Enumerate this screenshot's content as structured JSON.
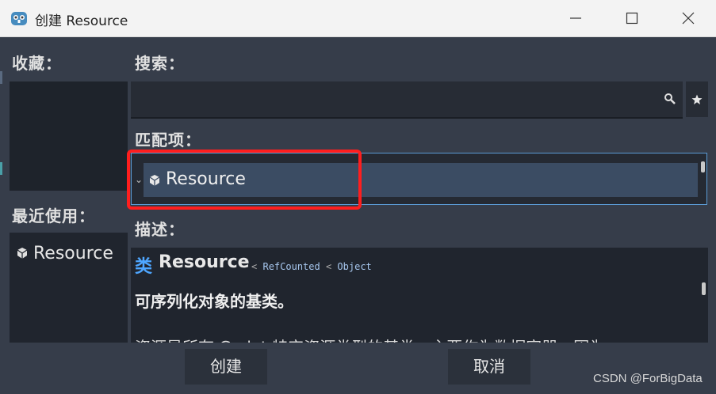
{
  "window": {
    "title": "创建 Resource"
  },
  "favorites": {
    "label": "收藏："
  },
  "recent": {
    "label": "最近使用：",
    "items": [
      {
        "label": "Resource",
        "icon": "resource-cube-icon"
      }
    ]
  },
  "search": {
    "label": "搜索：",
    "value": "",
    "placeholder": ""
  },
  "matches": {
    "label": "匹配项：",
    "items": [
      {
        "label": "Resource",
        "icon": "resource-cube-icon",
        "selected": true
      }
    ]
  },
  "description": {
    "label": "描述：",
    "class_keyword": "类",
    "class_name": "Resource",
    "inherits": [
      "RefCounted",
      "Object"
    ],
    "inherit_separator": "<",
    "brief": "可序列化对象的基类。",
    "body_partial": "资源是所有 Godot 特定资源类型的基类，主要作为数据容器，因为"
  },
  "buttons": {
    "create": "创建",
    "cancel": "取消"
  },
  "watermark": "CSDN @ForBigData",
  "colors": {
    "accent": "#4ea6ff",
    "highlight_box": "#ff1e1e",
    "selection": "#3b4c63"
  }
}
